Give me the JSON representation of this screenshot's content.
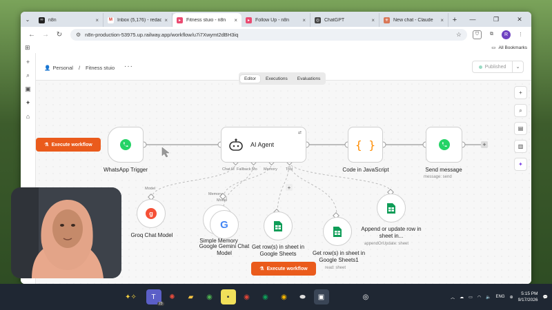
{
  "browser": {
    "tabs": [
      {
        "title": "n8n",
        "favicon_color": "#222222",
        "active": false
      },
      {
        "title": "Inbox (5,176) - redac",
        "favicon_color": "#d93025",
        "active": false
      },
      {
        "title": "Fitness stuio - n8n",
        "favicon_color": "#ea4b71",
        "active": true
      },
      {
        "title": "Follow Up - n8n",
        "favicon_color": "#ea4b71",
        "active": false
      },
      {
        "title": "ChatGPT",
        "favicon_color": "#444444",
        "active": false
      },
      {
        "title": "New chat - Claude",
        "favicon_color": "#d97757",
        "active": false
      }
    ],
    "url": "n8n-production-53975.up.railway.app/workflow/u7i7Xwymt2dBH3iq",
    "bookmarks_label": "All Bookmarks",
    "profile_initial": "R"
  },
  "n8n": {
    "breadcrumb": {
      "owner": "Personal",
      "separator": "/",
      "project": "Fitness stuio"
    },
    "published_label": "Published",
    "mode_tabs": [
      "Editor",
      "Executions",
      "Evaluations"
    ],
    "execute_label": "Execute workflow",
    "nodes": {
      "whatsapp_trigger": {
        "label": "WhatsApp Trigger"
      },
      "ai_agent": {
        "label": "AI Agent"
      },
      "code": {
        "label": "Code in JavaScript"
      },
      "send_message": {
        "label": "Send message",
        "sub": "message: send"
      },
      "groq": {
        "label": "Groq Chat Model"
      },
      "simple_memory": {
        "label": "Simple Memory"
      },
      "gemini": {
        "label": "Google Gemini Chat Model"
      },
      "get_rows": {
        "label": "Get row(s) in sheet in Google Sheets"
      },
      "get_rows1": {
        "label": "Get row(s) in sheet in Google Sheets1",
        "sub": "read: sheet"
      },
      "append": {
        "label": "Append or update row in sheet in...",
        "sub": "appendOrUpdate: sheet"
      }
    },
    "agent_ports": [
      "Chat M",
      "Fallback Mo",
      "Memory",
      "Tool"
    ],
    "port_labels": {
      "model1": "Model",
      "memory": "Memory",
      "model2": "Model"
    }
  },
  "taskbar": {
    "lang": "ENG",
    "time": "5:15 PM",
    "date": "9/17/2026",
    "badge": "23"
  },
  "colors": {
    "n8n_orange": "#ea5b1c",
    "whatsapp_green": "#25d366",
    "sheets_green": "#0f9d58",
    "groq_red": "#f55036"
  }
}
